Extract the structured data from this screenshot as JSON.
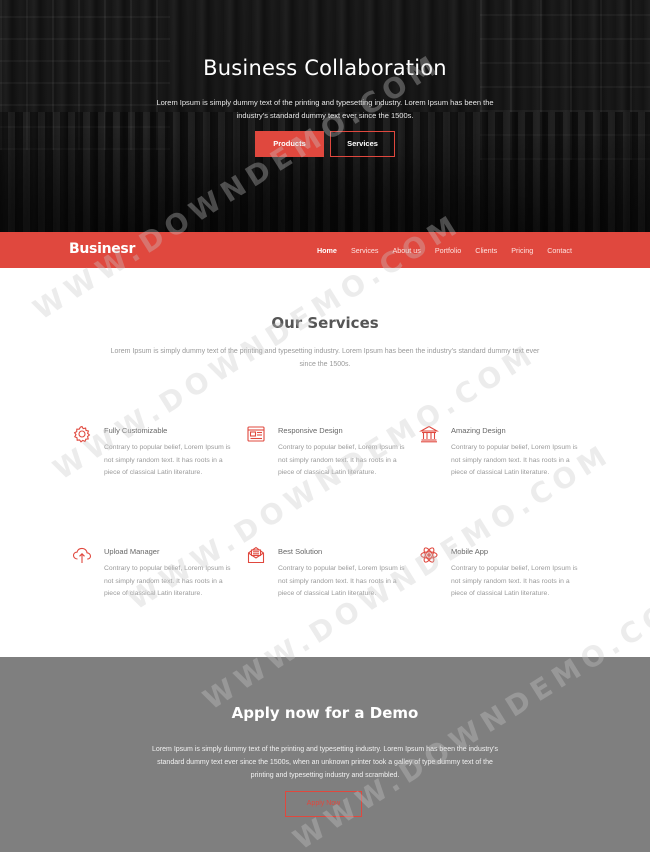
{
  "hero": {
    "title": "Business Collaboration",
    "text": "Lorem Ipsum is simply dummy text of the printing and typesetting industry. Lorem Ipsum has been the industry's standard dummy text ever since the 1500s.",
    "buttons": {
      "primary": "Products",
      "secondary": "Services"
    }
  },
  "navbar": {
    "logo": "Businesr",
    "items": [
      "Home",
      "Services",
      "About us",
      "Portfolio",
      "Clients",
      "Pricing",
      "Contact"
    ],
    "active": "Home"
  },
  "services": {
    "title": "Our Services",
    "subtitle": "Lorem Ipsum is simply dummy text of the printing and typesetting industry. Lorem Ipsum has been the industry's standard dummy text ever since the 1500s.",
    "items": [
      {
        "title": "Fully Customizable",
        "text": "Contrary to popular belief, Lorem Ipsum is not simply random text. It has roots in a piece of classical Latin literature.",
        "icon": "gear-icon"
      },
      {
        "title": "Responsive Design",
        "text": "Contrary to popular belief, Lorem Ipsum is not simply random text. It has roots in a piece of classical Latin literature.",
        "icon": "layout-icon"
      },
      {
        "title": "Amazing Design",
        "text": "Contrary to popular belief, Lorem Ipsum is not simply random text. It has roots in a piece of classical Latin literature.",
        "icon": "bank-icon"
      },
      {
        "title": "Upload Manager",
        "text": "Contrary to popular belief, Lorem Ipsum is not simply random text. It has roots in a piece of classical Latin literature.",
        "icon": "cloud-upload-icon"
      },
      {
        "title": "Best Solution",
        "text": "Contrary to popular belief, Lorem Ipsum is not simply random text. It has roots in a piece of classical Latin literature.",
        "icon": "mail-icon"
      },
      {
        "title": "Mobile App",
        "text": "Contrary to popular belief, Lorem Ipsum is not simply random text. It has roots in a piece of classical Latin literature.",
        "icon": "atom-icon"
      }
    ]
  },
  "demo": {
    "title": "Apply now for a Demo",
    "text": "Lorem Ipsum is simply dummy text of the printing and typesetting industry. Lorem Ipsum has been the industry's standard dummy text ever since the 1500s, when an unknown printer took a galley of type dummy text of the printing and typesetting industry and scrambled.",
    "button": "Apply Now"
  },
  "watermark": "WWW.DOWNDEMO.COM",
  "colors": {
    "accent": "#e0483e",
    "demo_bg": "#7f7f7f"
  }
}
